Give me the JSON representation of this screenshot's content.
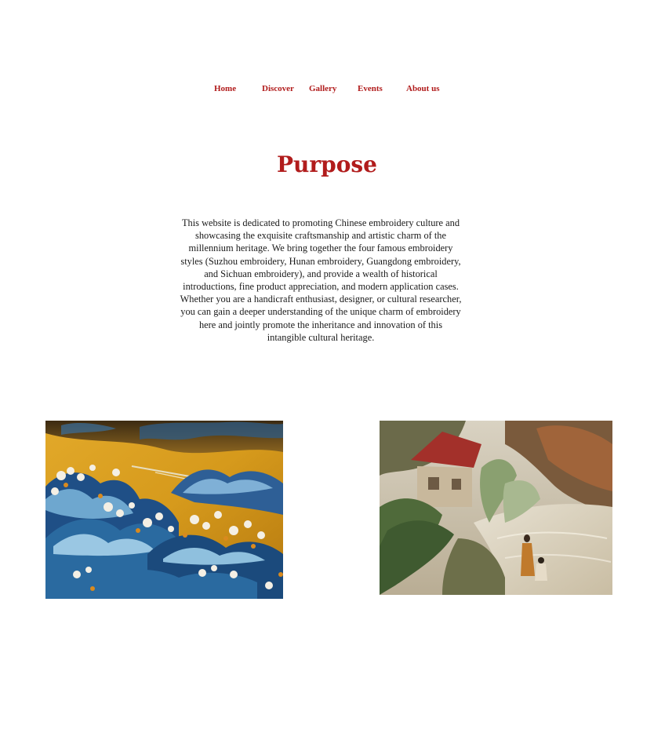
{
  "nav": {
    "items": [
      "Home",
      "Discover",
      "Gallery",
      "Events",
      "About us"
    ]
  },
  "section": {
    "title": "Purpose",
    "body": "This website is dedicated to promoting Chinese embroidery culture and showcasing the exquisite craftsmanship and artistic charm of the millennium heritage. We bring together the four famous embroidery styles (Suzhou embroidery, Hunan embroidery, Guangdong embroidery, and Sichuan embroidery), and provide a wealth of historical introductions, fine product appreciation, and modern application cases. Whether you are a handicraft enthusiast, designer, or cultural researcher, you can gain a deeper understanding of the unique charm of embroidery here and jointly promote the inheritance and innovation of this intangible cultural heritage."
  },
  "images": {
    "left": "embroidery-landscape-image",
    "right": "embroidered-village-scene-image"
  },
  "colors": {
    "accent": "#b11c1c",
    "text": "#1a1a1a",
    "background": "#ffffff"
  }
}
